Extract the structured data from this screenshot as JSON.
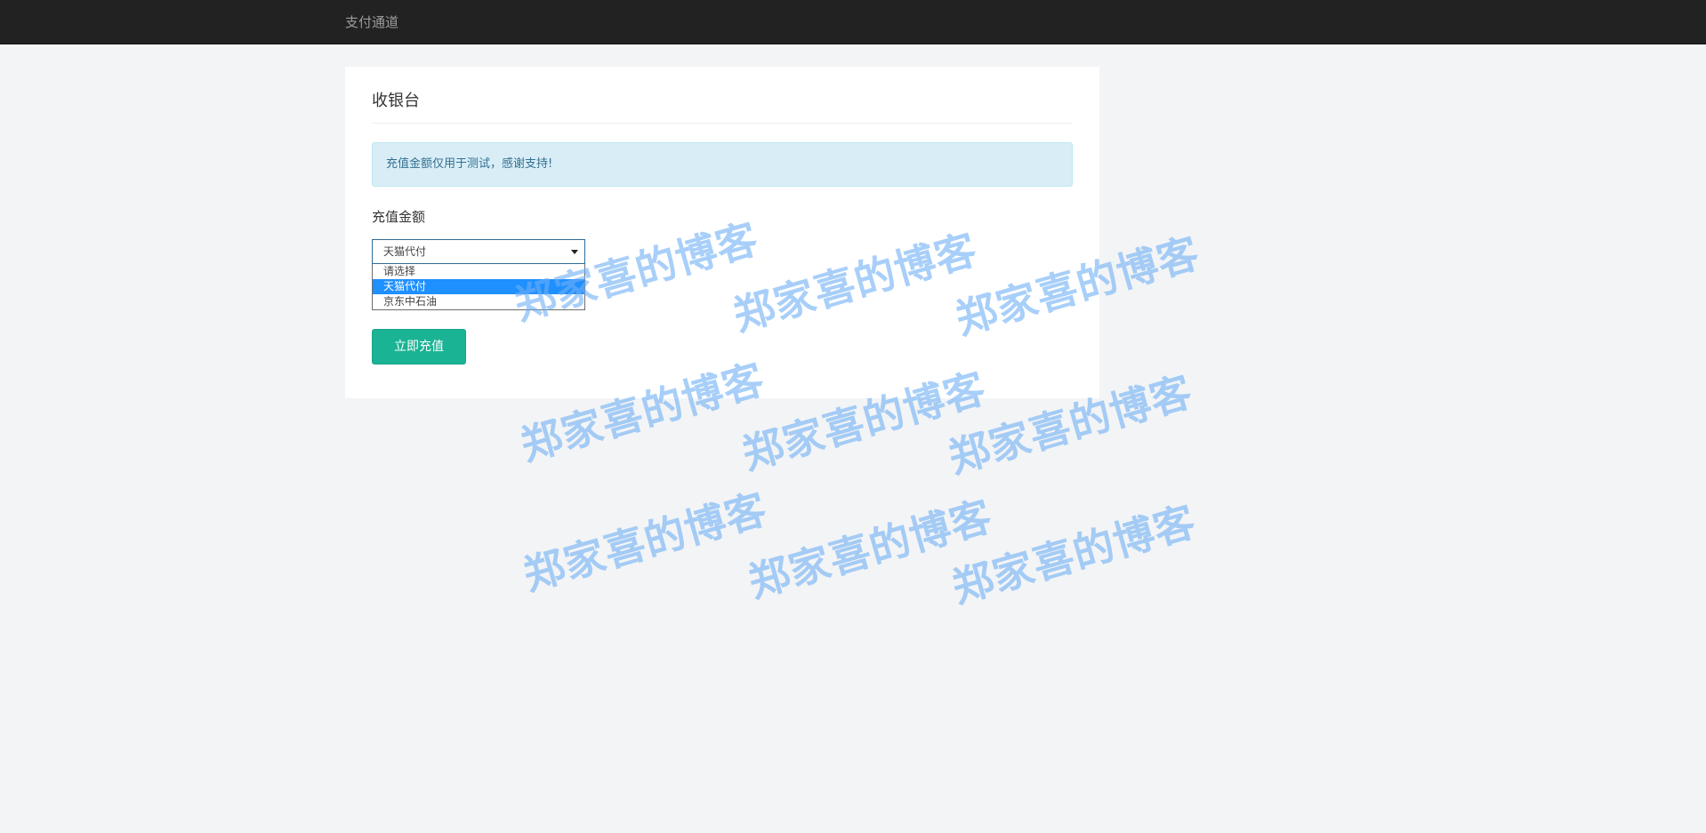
{
  "navbar": {
    "brand": "支付通道"
  },
  "panel": {
    "title": "收银台",
    "alert_text": "充值金额仅用于测试，感谢支持!",
    "amount_label": "充值金额",
    "select": {
      "value": "天猫代付",
      "options": [
        {
          "label": "请选择",
          "selected": false
        },
        {
          "label": "天猫代付",
          "selected": true
        },
        {
          "label": "京东中石油",
          "selected": false
        }
      ]
    },
    "submit_label": "立即充值"
  },
  "watermark": {
    "text": "郑家喜的博客"
  },
  "colors": {
    "navbar_bg": "#222222",
    "page_bg": "#f3f4f6",
    "alert_bg": "#d9edf7",
    "button_bg": "#1ab394",
    "option_highlight": "#1e90ff",
    "watermark": "#6eaff5"
  }
}
